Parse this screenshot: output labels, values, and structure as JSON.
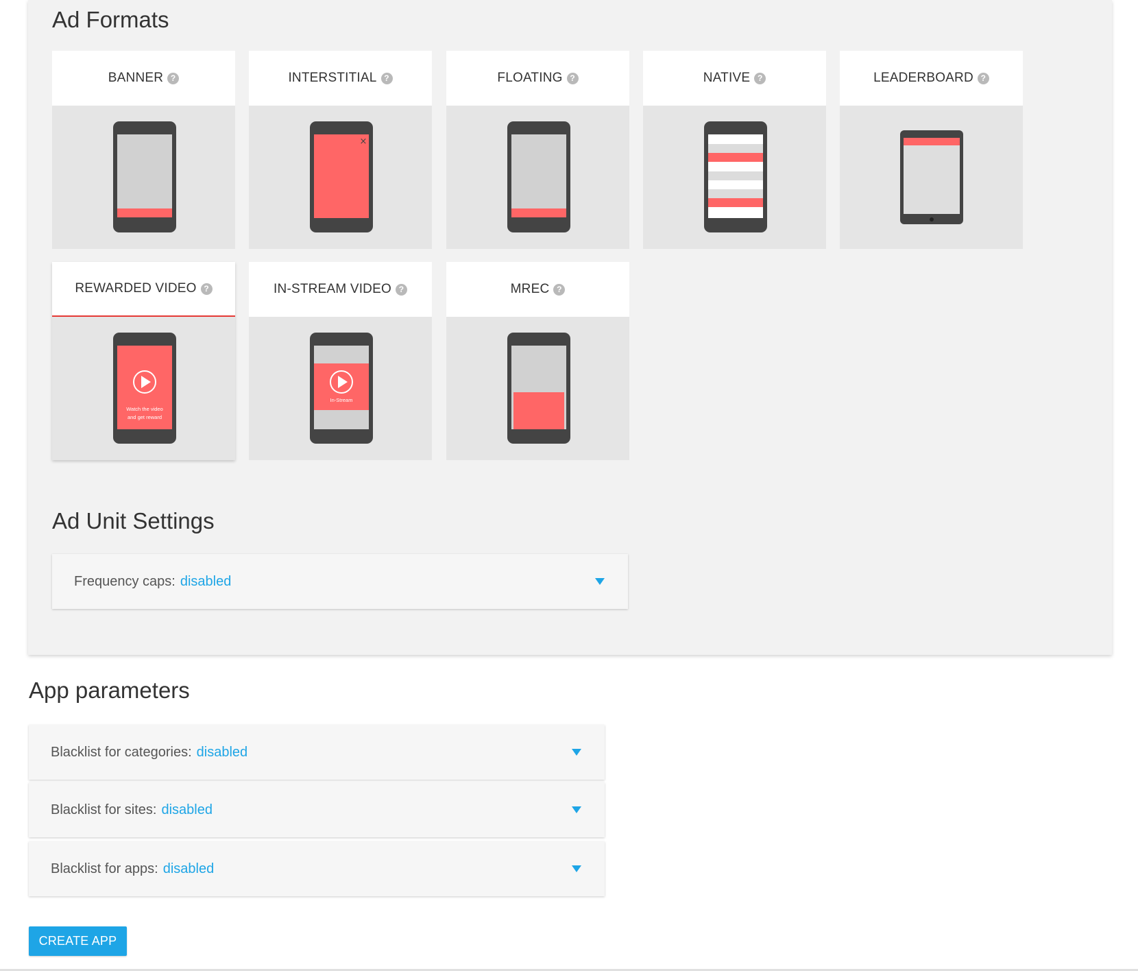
{
  "ad_formats": {
    "title": "Ad Formats",
    "cards": [
      {
        "label": "BANNER"
      },
      {
        "label": "INTERSTITIAL",
        "close_glyph": "×"
      },
      {
        "label": "FLOATING"
      },
      {
        "label": "NATIVE"
      },
      {
        "label": "LEADERBOARD"
      },
      {
        "label": "REWARDED VIDEO",
        "caption_line1": "Watch the video",
        "caption_line2": "and get reward",
        "selected": true
      },
      {
        "label": "IN-STREAM VIDEO",
        "caption": "In-Stream"
      },
      {
        "label": "MREC"
      }
    ],
    "help_glyph": "?"
  },
  "ad_unit_settings": {
    "title": "Ad Unit Settings",
    "frequency_caps": {
      "label": "Frequency caps:",
      "value": "disabled"
    }
  },
  "app_parameters": {
    "title": "App parameters",
    "items": [
      {
        "label": "Blacklist for categories:",
        "value": "disabled"
      },
      {
        "label": "Blacklist for sites:",
        "value": "disabled"
      },
      {
        "label": "Blacklist for apps:",
        "value": "disabled"
      }
    ]
  },
  "create_button": {
    "label": "CREATE APP"
  },
  "colors": {
    "accent": "#1ea5e6",
    "ad_red": "#ff6666",
    "phone_body": "#444444",
    "selected_underline": "#e53935"
  }
}
